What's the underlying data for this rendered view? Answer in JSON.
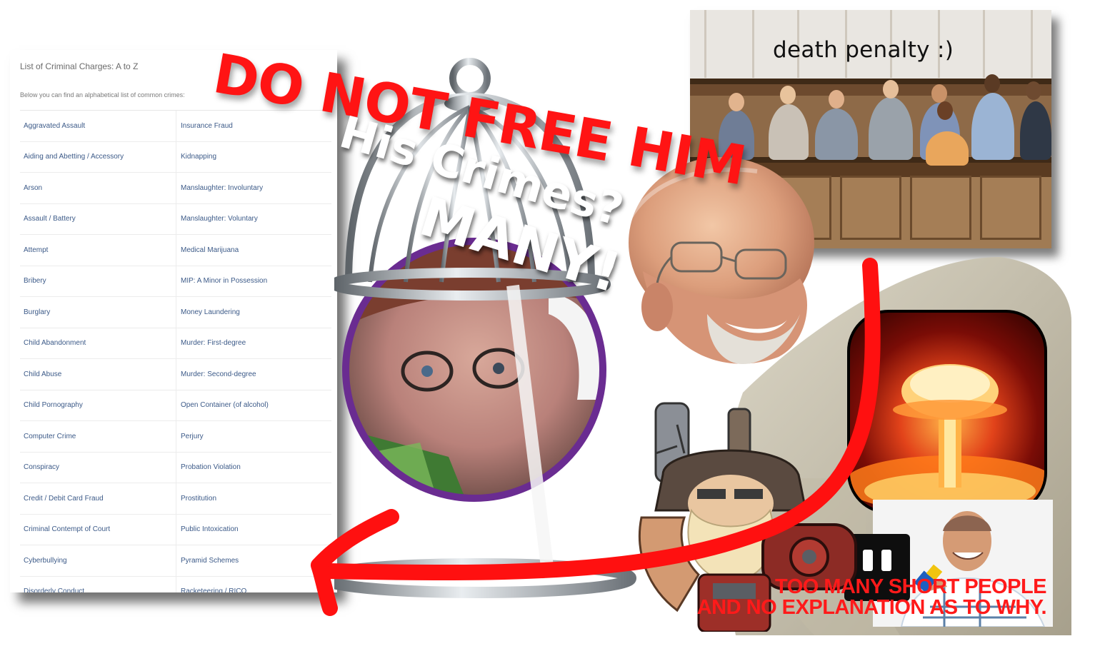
{
  "headline": "DO NOT FREE HIM",
  "question": "His Crimes?",
  "answer": "MANY!",
  "jury_caption": "death penalty :)",
  "bottom_caption": {
    "line1": "TOO MANY SHORT PEOPLE",
    "line2": "AND NO EXPLANATION AS TO WHY."
  },
  "crimes_panel": {
    "title": "List of Criminal Charges: A to Z",
    "subtitle": "Below you can find an alphabetical list of common crimes:",
    "rows": [
      [
        "Aggravated Assault",
        "Insurance Fraud"
      ],
      [
        "Aiding and Abetting / Accessory",
        "Kidnapping"
      ],
      [
        "Arson",
        "Manslaughter: Involuntary"
      ],
      [
        "Assault / Battery",
        "Manslaughter: Voluntary"
      ],
      [
        "Attempt",
        "Medical Marijuana"
      ],
      [
        "Bribery",
        "MIP: A Minor in Possession"
      ],
      [
        "Burglary",
        "Money Laundering"
      ],
      [
        "Child Abandonment",
        "Murder: First-degree"
      ],
      [
        "Child Abuse",
        "Murder: Second-degree"
      ],
      [
        "Child Pornography",
        "Open Container (of alcohol)"
      ],
      [
        "Computer Crime",
        "Perjury"
      ],
      [
        "Conspiracy",
        "Probation Violation"
      ],
      [
        "Credit / Debit Card Fraud",
        "Prostitution"
      ],
      [
        "Criminal Contempt of Court",
        "Public Intoxication"
      ],
      [
        "Cyberbullying",
        "Pyramid Schemes"
      ],
      [
        "Disorderly Conduct",
        "Racketeering / RICO"
      ]
    ]
  },
  "colors": {
    "headline": "#ff1414",
    "overlay_text": "#ffffff",
    "arrow": "#ff1010",
    "link": "#3c5a88",
    "cage_frame": "#8f959b",
    "cage_ring": "#6a2c91"
  },
  "icons": [
    "twitch-icon"
  ]
}
